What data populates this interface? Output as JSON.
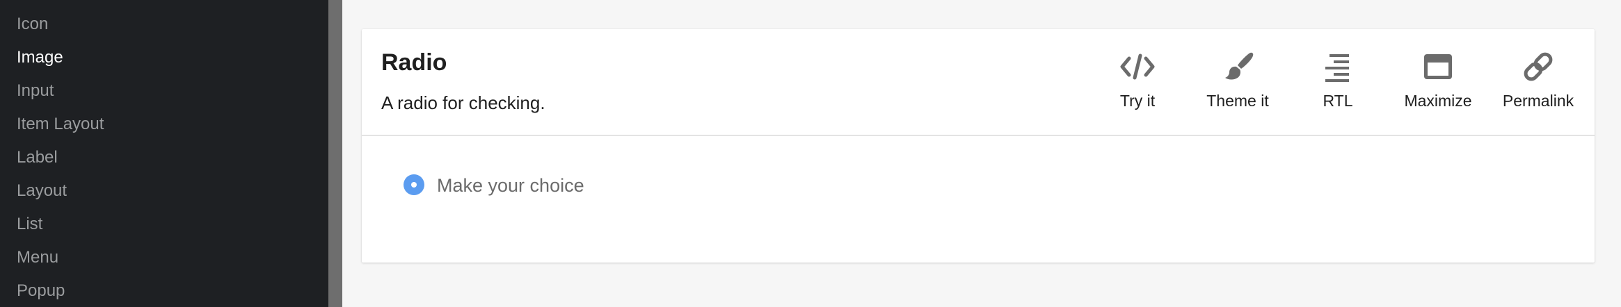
{
  "sidebar": {
    "items": [
      {
        "label": "Icon",
        "active": false
      },
      {
        "label": "Image",
        "active": true
      },
      {
        "label": "Input",
        "active": false
      },
      {
        "label": "Item Layout",
        "active": false
      },
      {
        "label": "Label",
        "active": false
      },
      {
        "label": "Layout",
        "active": false
      },
      {
        "label": "List",
        "active": false
      },
      {
        "label": "Menu",
        "active": false
      },
      {
        "label": "Popup",
        "active": false
      }
    ]
  },
  "card": {
    "title": "Radio",
    "subtitle": "A radio for checking.",
    "toolbar": [
      {
        "label": "Try it",
        "icon": "code-icon"
      },
      {
        "label": "Theme it",
        "icon": "paintbrush-icon"
      },
      {
        "label": "RTL",
        "icon": "align-right-icon"
      },
      {
        "label": "Maximize",
        "icon": "maximize-window-icon"
      },
      {
        "label": "Permalink",
        "icon": "link-icon"
      }
    ],
    "radio": {
      "label": "Make your choice",
      "checked": true
    }
  },
  "colors": {
    "sidebar_bg": "#1e2023",
    "sidebar_text": "#9a9c9e",
    "sidebar_active_text": "#ffffff",
    "radio_accent": "#5b9cf0",
    "icon_gray": "#6b6b6b"
  }
}
